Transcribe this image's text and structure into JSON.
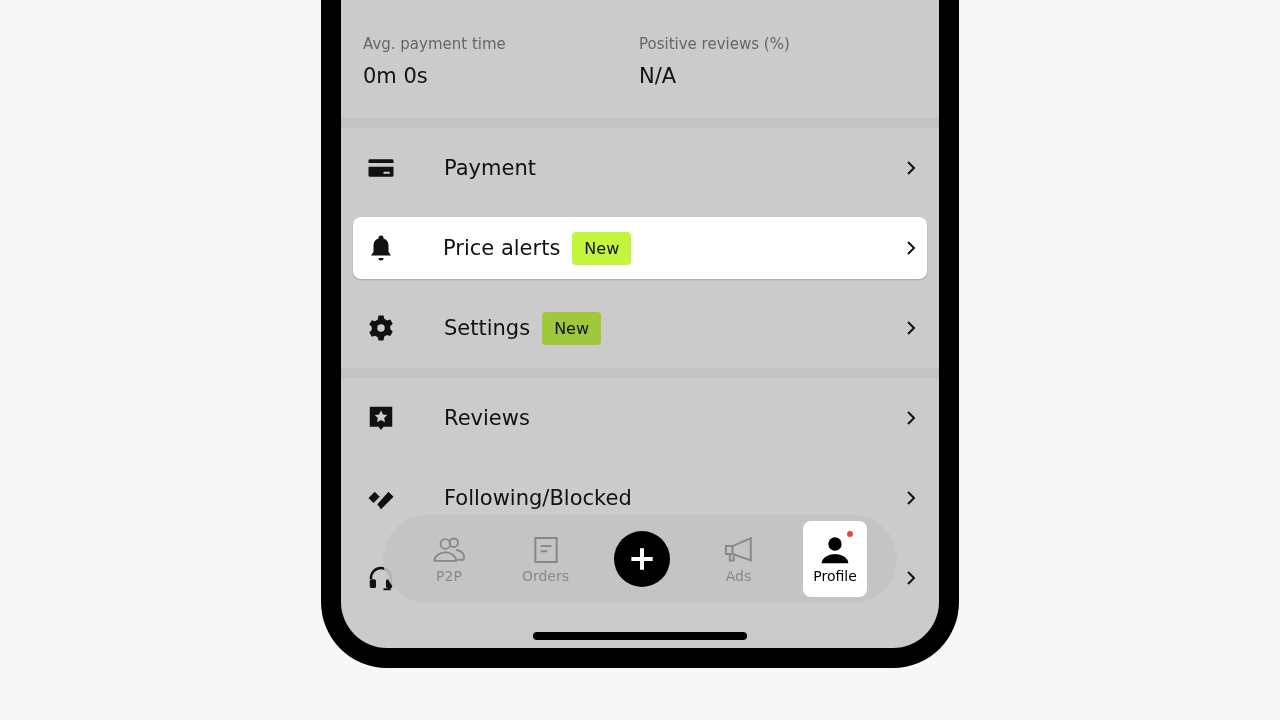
{
  "stats": [
    {
      "label": "Avg. payment time",
      "value": "0m 0s"
    },
    {
      "label": "Positive reviews (%)",
      "value": "N/A"
    }
  ],
  "menu_groups": [
    [
      {
        "kind": "card",
        "label": "Payment",
        "highlighted": false
      },
      {
        "kind": "bell",
        "label": "Price alerts",
        "badge": "New",
        "highlighted": true
      },
      {
        "kind": "gear",
        "label": "Settings",
        "badge": "New",
        "highlighted": false
      }
    ],
    [
      {
        "kind": "review",
        "label": "Reviews",
        "highlighted": false
      },
      {
        "kind": "follow",
        "label": "Following/Blocked",
        "highlighted": false
      },
      {
        "kind": "headset"
      }
    ]
  ],
  "nav": [
    {
      "kind": "p2p",
      "label": "P2P",
      "selected": false
    },
    {
      "kind": "orders",
      "label": "Orders",
      "selected": false
    },
    {
      "kind": "plus"
    },
    {
      "kind": "ads",
      "label": "Ads",
      "selected": false
    },
    {
      "kind": "profile",
      "label": "Profile",
      "selected": true,
      "notification": true
    }
  ]
}
